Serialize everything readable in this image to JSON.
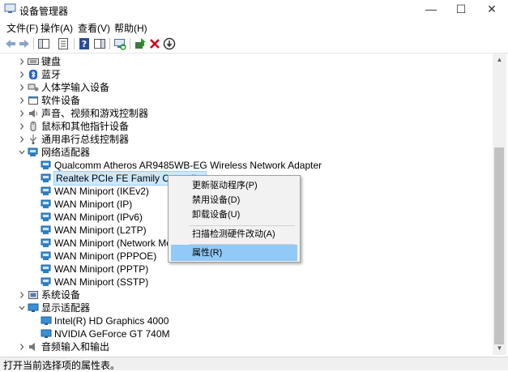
{
  "window": {
    "title": "设备管理器",
    "minimize_glyph": "—",
    "maximize_glyph": "☐",
    "close_glyph": "✕"
  },
  "menu": [
    "文件(F)",
    "操作(A)",
    "查看(V)",
    "帮助(H)"
  ],
  "toolbar_icons": [
    "back-icon",
    "forward-icon",
    "show-hide-console-tree-icon",
    "properties-list-icon",
    "help-icon",
    "action-pane-icon",
    "scan-hardware-icon",
    "update-driver-icon",
    "uninstall-icon",
    "disable-icon"
  ],
  "tree": [
    {
      "label": "键盘",
      "indent": 0,
      "exp": "closed",
      "icon": "keyboard-icon"
    },
    {
      "label": "蓝牙",
      "indent": 0,
      "exp": "closed",
      "icon": "bluetooth-icon"
    },
    {
      "label": "人体学输入设备",
      "indent": 0,
      "exp": "closed",
      "icon": "hid-icon"
    },
    {
      "label": "软件设备",
      "indent": 0,
      "exp": "closed",
      "icon": "software-device-icon"
    },
    {
      "label": "声音、视频和游戏控制器",
      "indent": 0,
      "exp": "closed",
      "icon": "speaker-icon"
    },
    {
      "label": "鼠标和其他指针设备",
      "indent": 0,
      "exp": "closed",
      "icon": "mouse-icon"
    },
    {
      "label": "通用串行总线控制器",
      "indent": 0,
      "exp": "closed",
      "icon": "usb-icon"
    },
    {
      "label": "网络适配器",
      "indent": 0,
      "exp": "open",
      "icon": "network-adapter-icon"
    },
    {
      "label": "Qualcomm Atheros AR9485WB-EG Wireless Network Adapter",
      "indent": 1,
      "exp": "none",
      "icon": "network-adapter-icon"
    },
    {
      "label": "Realtek PCIe FE Family Controller",
      "indent": 1,
      "exp": "none",
      "icon": "network-adapter-icon",
      "selected": true
    },
    {
      "label": "WAN Miniport (IKEv2)",
      "indent": 1,
      "exp": "none",
      "icon": "network-adapter-icon"
    },
    {
      "label": "WAN Miniport (IP)",
      "indent": 1,
      "exp": "none",
      "icon": "network-adapter-icon"
    },
    {
      "label": "WAN Miniport (IPv6)",
      "indent": 1,
      "exp": "none",
      "icon": "network-adapter-icon"
    },
    {
      "label": "WAN Miniport (L2TP)",
      "indent": 1,
      "exp": "none",
      "icon": "network-adapter-icon"
    },
    {
      "label": "WAN Miniport (Network Monitor)",
      "indent": 1,
      "exp": "none",
      "icon": "network-adapter-icon"
    },
    {
      "label": "WAN Miniport (PPPOE)",
      "indent": 1,
      "exp": "none",
      "icon": "network-adapter-icon"
    },
    {
      "label": "WAN Miniport (PPTP)",
      "indent": 1,
      "exp": "none",
      "icon": "network-adapter-icon"
    },
    {
      "label": "WAN Miniport (SSTP)",
      "indent": 1,
      "exp": "none",
      "icon": "network-adapter-icon"
    },
    {
      "label": "系统设备",
      "indent": 0,
      "exp": "closed",
      "icon": "system-device-icon"
    },
    {
      "label": "显示适配器",
      "indent": 0,
      "exp": "open",
      "icon": "display-adapter-icon"
    },
    {
      "label": "Intel(R) HD Graphics 4000",
      "indent": 1,
      "exp": "none",
      "icon": "display-adapter-icon"
    },
    {
      "label": "NVIDIA GeForce GT 740M",
      "indent": 1,
      "exp": "none",
      "icon": "display-adapter-icon"
    },
    {
      "label": "音频输入和输出",
      "indent": 0,
      "exp": "closed",
      "icon": "audio-io-icon"
    }
  ],
  "context_menu": {
    "items": [
      "更新驱动程序(P)",
      "禁用设备(D)",
      "卸载设备(U)",
      "扫描检测硬件改动(A)",
      "属性(R)"
    ],
    "highlighted": "属性(R)"
  },
  "status": "打开当前选择项的属性表。",
  "colors": {
    "selection": "#cce8ff",
    "menu_highlight": "#91c9f7",
    "adapter_icon": "#2f7fc1",
    "uninstall_red": "#d0021b",
    "scan_green": "#2b9a2b"
  }
}
